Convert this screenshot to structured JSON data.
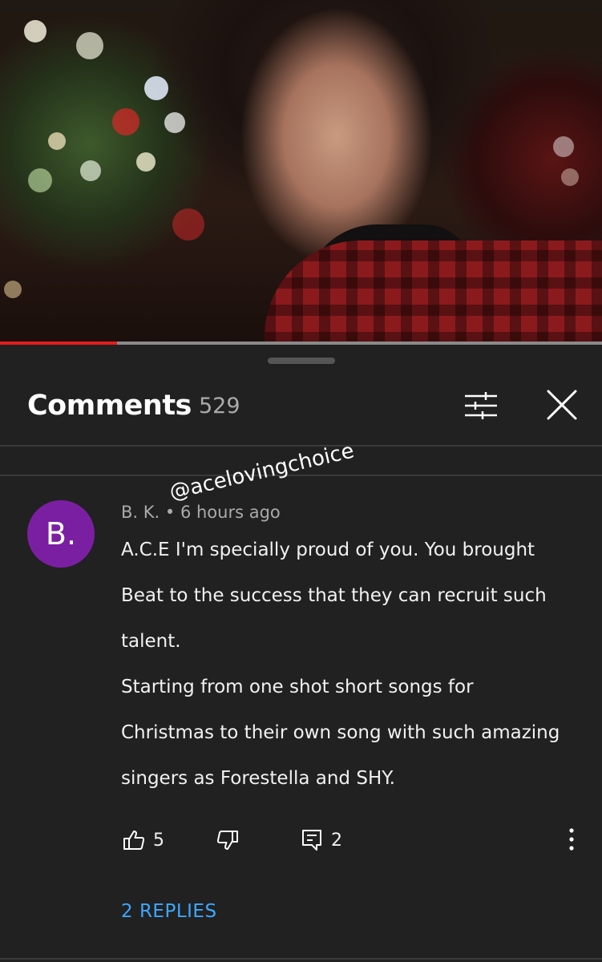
{
  "video": {
    "progress_percent": 19.5,
    "progress_color": "#e41c1c"
  },
  "comments": {
    "title": "Comments",
    "count": "529",
    "filter_icon": "sort-filter-icon",
    "close_icon": "close-icon"
  },
  "watermark": "@acelovingchoice",
  "comment": {
    "avatar_letter": "B.",
    "avatar_color": "#7b1fa2",
    "meta": "B. K. • 6 hours ago",
    "lines": [
      "A.C.E I'm specially proud of you. You brought",
      "Beat to the success that they can recruit such",
      "talent.",
      "Starting from one shot short songs for",
      "Christmas to their own song with such amazing",
      "singers as Forestella and SHY."
    ],
    "likes": "5",
    "reply_count": "2",
    "replies_label": "2 REPLIES"
  }
}
